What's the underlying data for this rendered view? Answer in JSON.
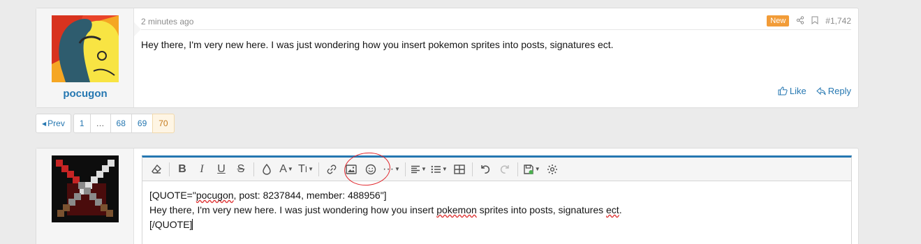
{
  "post": {
    "username": "pocugon",
    "time": "2 minutes ago",
    "new_badge": "New",
    "post_number": "#1,742",
    "body": "Hey there, I'm very new here. I was just wondering how you insert pokemon sprites into posts, signatures ect.",
    "like_label": "Like",
    "reply_label": "Reply"
  },
  "pagination": {
    "prev_label": "Prev",
    "pages": [
      "1",
      "…",
      "68",
      "69",
      "70"
    ],
    "current": "70"
  },
  "editor": {
    "toolbar_icons": [
      "eraser-icon",
      "bold-icon",
      "italic-icon",
      "underline-icon",
      "strike-icon",
      "color-icon",
      "font-size-icon",
      "text-style-icon",
      "link-icon",
      "image-icon",
      "smilie-icon",
      "more-icon",
      "align-icon",
      "list-icon",
      "table-icon",
      "undo-icon",
      "redo-icon",
      "drafts-icon",
      "settings-icon"
    ],
    "lines": {
      "l1_pre": "[QUOTE=\"",
      "l1_user": "pocugon",
      "l1_post": ", post: 8237844, member: 488956\"]",
      "l2_pre": "Hey there, I'm very new here. I was just wondering how you insert ",
      "l2_spell": "pokemon",
      "l2_mid": " sprites into posts, signatures ",
      "l2_spell2": "ect",
      "l2_end": ".",
      "l3": "[/QUOTE]"
    }
  },
  "colors": {
    "accent": "#2577b1",
    "new_badge": "#f29c38",
    "annotation": "#e0242a"
  }
}
